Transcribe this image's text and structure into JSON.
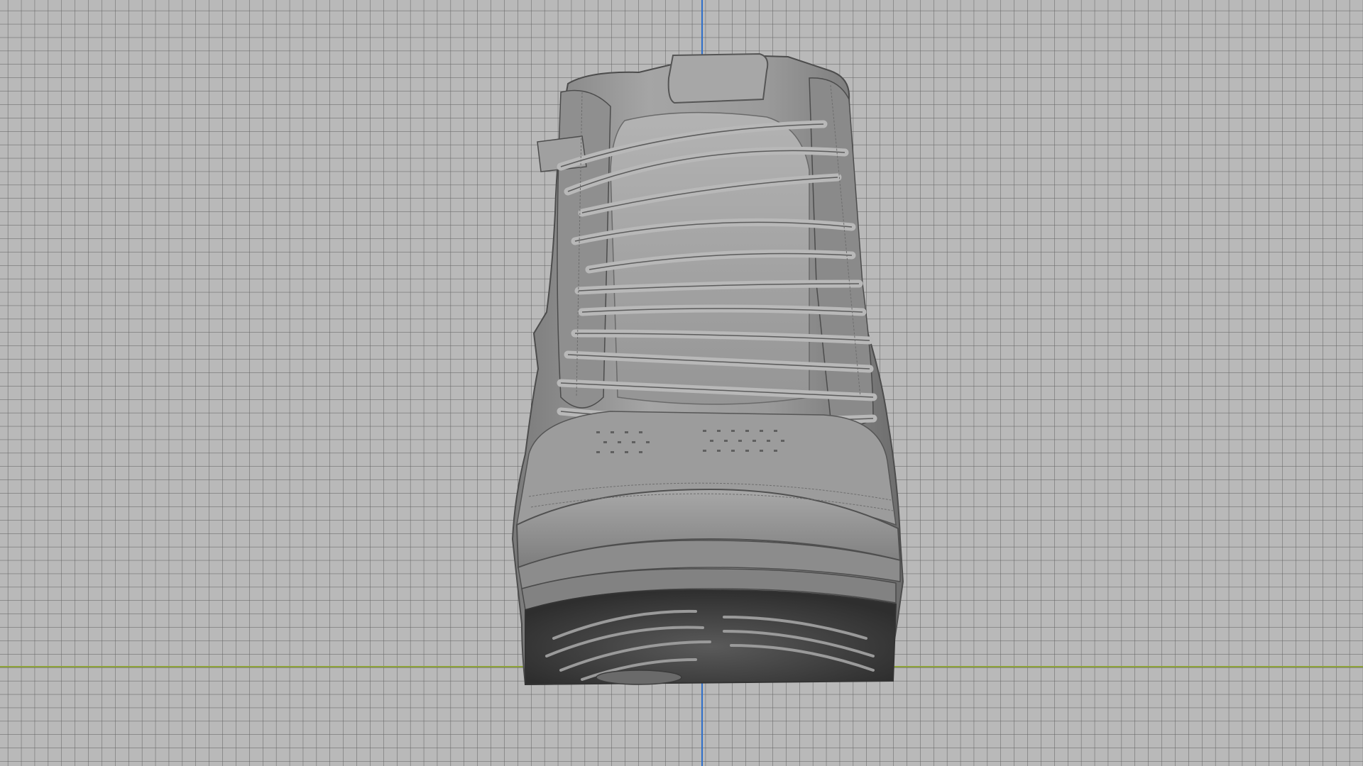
{
  "viewport": {
    "mode": "front-orthographic",
    "background": "#b9b9b9",
    "grid_color": "#5f5f5f",
    "axis_colors": {
      "vertical": "#2f6fc9",
      "horizontal": "#8ea33a"
    },
    "model": {
      "name": "sneaker-high-top",
      "shading": "solid-gray",
      "base_color": "#8e8e8e",
      "highlight_color": "#bcbcbc",
      "shadow_color": "#4a4a4a"
    }
  }
}
